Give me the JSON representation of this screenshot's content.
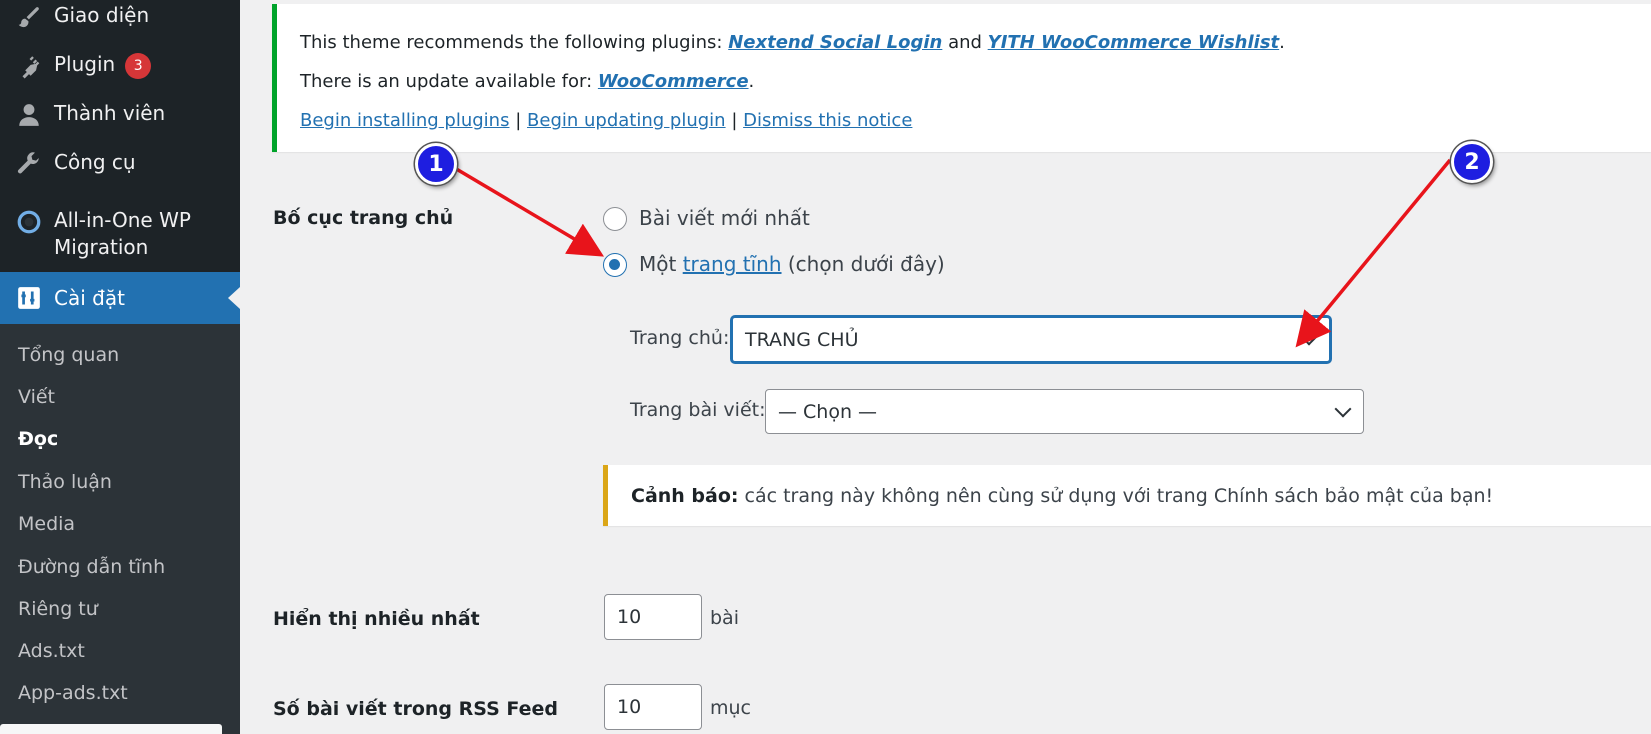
{
  "sidebar": {
    "items": [
      {
        "label": "Giao diện",
        "icon": "paintbrush-icon"
      },
      {
        "label": "Plugin",
        "icon": "plugin-icon",
        "badge": "3"
      },
      {
        "label": "Thành viên",
        "icon": "users-icon"
      },
      {
        "label": "Công cụ",
        "icon": "wrench-icon"
      },
      {
        "label_line1": "All-in-One WP",
        "label_line2": "Migration",
        "icon": "migration-icon"
      },
      {
        "label": "Cài đặt",
        "icon": "settings-icon"
      }
    ],
    "submenu": [
      "Tổng quan",
      "Viết",
      "Đọc",
      "Thảo luận",
      "Media",
      "Đường dẫn tĩnh",
      "Riêng tư",
      "Ads.txt",
      "App-ads.txt"
    ],
    "current_submenu": "Đọc"
  },
  "notice": {
    "line1_prefix": "This theme recommends the following plugins:",
    "plugin1": "Nextend Social Login",
    "and": "and",
    "plugin2": "YITH WooCommerce Wishlist",
    "line2_prefix": "There is an update available for:",
    "update_plugin": "WooCommerce",
    "link_install": "Begin installing plugins",
    "link_update": "Begin updating plugin",
    "link_dismiss": "Dismiss this notice",
    "separator": "|",
    "accent_color": "#00a32a"
  },
  "form": {
    "homepage_label": "Bố cục trang chủ",
    "option_latest": "Bài viết mới nhất",
    "option_static_prefix": "Một",
    "option_static_link": "trang tĩnh",
    "option_static_suffix": "(chọn dưới đây)",
    "selected_option": "static",
    "homepage_select_label": "Trang chủ:",
    "homepage_select_value": "TRANG CHỦ",
    "posts_select_label": "Trang bài viết:",
    "posts_select_value": "— Chọn —",
    "warning_bold": "Cảnh báo:",
    "warning_text": "các trang này không nên cùng sử dụng với trang Chính sách bảo mật của bạn!",
    "posts_per_page_label": "Hiển thị nhiều nhất",
    "posts_per_page_value": "10",
    "posts_per_page_unit": "bài",
    "rss_label": "Số bài viết trong RSS Feed",
    "rss_value": "10",
    "rss_unit": "mục"
  },
  "annotations": {
    "marker1": "1",
    "marker2": "2",
    "arrow_color": "#e8141b",
    "marker_color": "#1e1ee0"
  },
  "colors": {
    "admin_bar": "#1d2327",
    "submenu_bg": "#2c3338",
    "accent": "#2271b1",
    "warning": "#dba617"
  }
}
